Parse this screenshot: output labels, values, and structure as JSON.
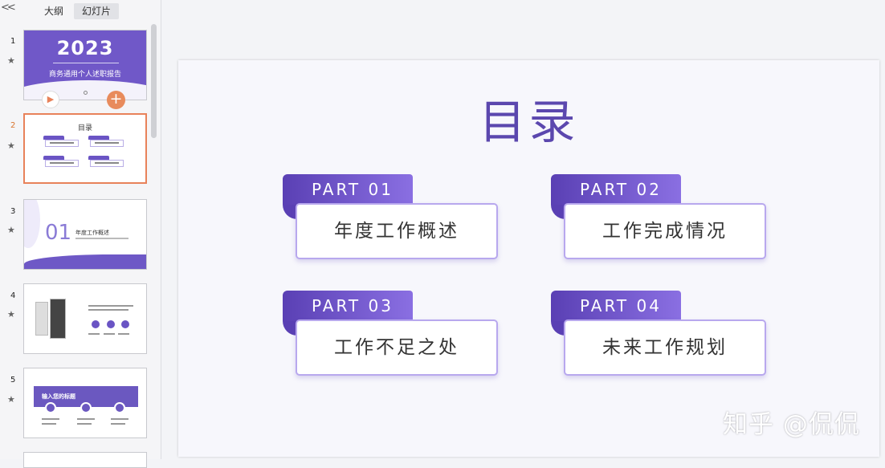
{
  "panel": {
    "tabs": [
      {
        "label": "大纲",
        "active": false
      },
      {
        "label": "幻灯片",
        "active": true
      }
    ]
  },
  "thumbnails": [
    {
      "number": "1",
      "year": "2023",
      "title": "商务通用个人述职报告"
    },
    {
      "number": "2",
      "title": "目录",
      "active": true
    },
    {
      "number": "3",
      "big_number": "01",
      "title": "年度工作概述"
    },
    {
      "number": "4"
    },
    {
      "number": "5",
      "title": "输入您的标题"
    }
  ],
  "slide": {
    "title": "目录",
    "items": [
      {
        "part": "PART  01",
        "label": "年度工作概述"
      },
      {
        "part": "PART  02",
        "label": "工作完成情况"
      },
      {
        "part": "PART  03",
        "label": "工作不足之处"
      },
      {
        "part": "PART  04",
        "label": "未来工作规划"
      }
    ]
  },
  "watermark": "知乎 @侃侃",
  "colors": {
    "accent": "#5b47ae",
    "active_thumb_border": "#e8825a",
    "tag_gradient_start": "#5a40b4",
    "tag_gradient_end": "#8a6fe2"
  },
  "icons": {
    "collapse": "double-chevron-left-icon",
    "star": "star-icon",
    "play": "play-icon",
    "add": "plus-icon"
  }
}
